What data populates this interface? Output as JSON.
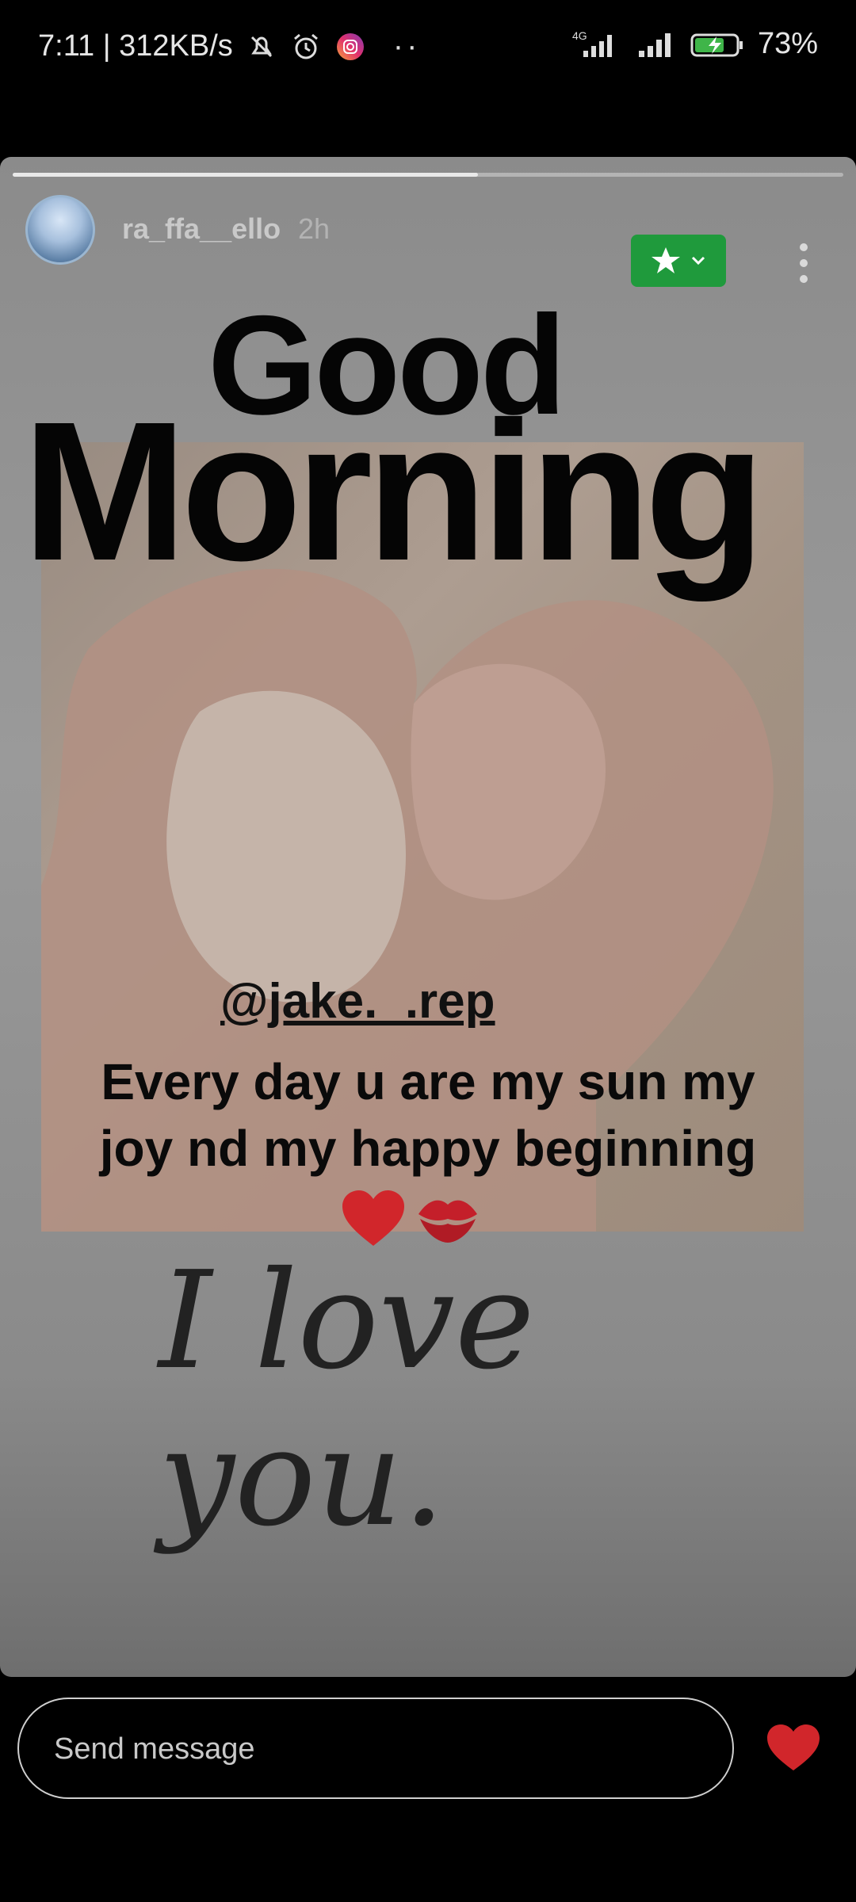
{
  "status_bar": {
    "time_speed": "7:11 | 312KB/s",
    "network": "4G",
    "battery": "73%"
  },
  "story": {
    "progress": 0.56,
    "username": "ra_ffa__ello",
    "time_ago": "2h",
    "content": {
      "title_line1": "Good",
      "title_line2": "Morning",
      "mention": "@jake._.rep",
      "caption_line1": "Every day u are my sun my",
      "caption_line2": "joy nd my happy beginning",
      "emojis": [
        "red-heart",
        "kiss-mark"
      ],
      "script_text": "I love you."
    }
  },
  "composer": {
    "placeholder": "Send message"
  },
  "colors": {
    "close_friends_green": "#1f9a3c",
    "like_red": "#d1262b"
  }
}
